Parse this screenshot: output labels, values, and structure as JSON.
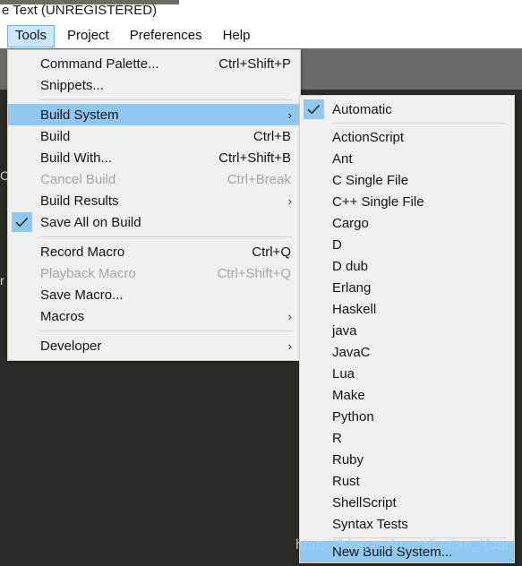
{
  "window": {
    "title": "e Text (UNREGISTERED)"
  },
  "menubar": {
    "items": [
      {
        "label": "Tools",
        "active": true
      },
      {
        "label": "Project",
        "active": false
      },
      {
        "label": "Preferences",
        "active": false
      },
      {
        "label": "Help",
        "active": false
      }
    ]
  },
  "editor": {
    "ghost_chars": [
      "C",
      "r"
    ]
  },
  "tools_menu": {
    "items": [
      {
        "label": "Command Palette...",
        "accel": "Ctrl+Shift+P",
        "kind": "item"
      },
      {
        "label": "Snippets...",
        "accel": "",
        "kind": "item"
      },
      {
        "kind": "separator"
      },
      {
        "label": "Build System",
        "accel": "",
        "kind": "submenu",
        "selected": true,
        "arrow": "›"
      },
      {
        "label": "Build",
        "accel": "Ctrl+B",
        "kind": "item"
      },
      {
        "label": "Build With...",
        "accel": "Ctrl+Shift+B",
        "kind": "item"
      },
      {
        "label": "Cancel Build",
        "accel": "Ctrl+Break",
        "kind": "item",
        "disabled": true
      },
      {
        "label": "Build Results",
        "accel": "",
        "kind": "submenu",
        "arrow": "›"
      },
      {
        "label": "Save All on Build",
        "accel": "",
        "kind": "checked",
        "checked": true
      },
      {
        "kind": "separator"
      },
      {
        "label": "Record Macro",
        "accel": "Ctrl+Q",
        "kind": "item"
      },
      {
        "label": "Playback Macro",
        "accel": "Ctrl+Shift+Q",
        "kind": "item",
        "disabled": true
      },
      {
        "label": "Save Macro...",
        "accel": "",
        "kind": "item"
      },
      {
        "label": "Macros",
        "accel": "",
        "kind": "submenu",
        "arrow": "›"
      },
      {
        "kind": "separator"
      },
      {
        "label": "Developer",
        "accel": "",
        "kind": "submenu",
        "arrow": "›"
      }
    ]
  },
  "build_system_submenu": {
    "items": [
      {
        "label": "Automatic",
        "kind": "checked",
        "checked": true
      },
      {
        "kind": "separator"
      },
      {
        "label": "ActionScript",
        "kind": "item"
      },
      {
        "label": "Ant",
        "kind": "item"
      },
      {
        "label": "C Single File",
        "kind": "item"
      },
      {
        "label": "C++ Single File",
        "kind": "item"
      },
      {
        "label": "Cargo",
        "kind": "item"
      },
      {
        "label": "D",
        "kind": "item"
      },
      {
        "label": "D dub",
        "kind": "item"
      },
      {
        "label": "Erlang",
        "kind": "item"
      },
      {
        "label": "Haskell",
        "kind": "item"
      },
      {
        "label": "java",
        "kind": "item"
      },
      {
        "label": "JavaC",
        "kind": "item"
      },
      {
        "label": "Lua",
        "kind": "item"
      },
      {
        "label": "Make",
        "kind": "item"
      },
      {
        "label": "Python",
        "kind": "item"
      },
      {
        "label": "R",
        "kind": "item"
      },
      {
        "label": "Ruby",
        "kind": "item"
      },
      {
        "label": "Rust",
        "kind": "item"
      },
      {
        "label": "ShellScript",
        "kind": "item"
      },
      {
        "label": "Syntax Tests",
        "kind": "item"
      },
      {
        "kind": "separator"
      },
      {
        "label": "New Build System...",
        "kind": "item",
        "selected": true
      }
    ]
  },
  "watermark": {
    "text": "https://blog.csdn.net/Letian_Yuan"
  },
  "colors": {
    "menu_bg": "#f0f0f0",
    "highlight_blue": "#8fc8f2",
    "menubar_active": "#cce8ff",
    "editor_dark": "#2b2a25",
    "toolbar_gray": "#6b6b66",
    "text": "#141414",
    "text_disabled": "#a6a6a6"
  }
}
